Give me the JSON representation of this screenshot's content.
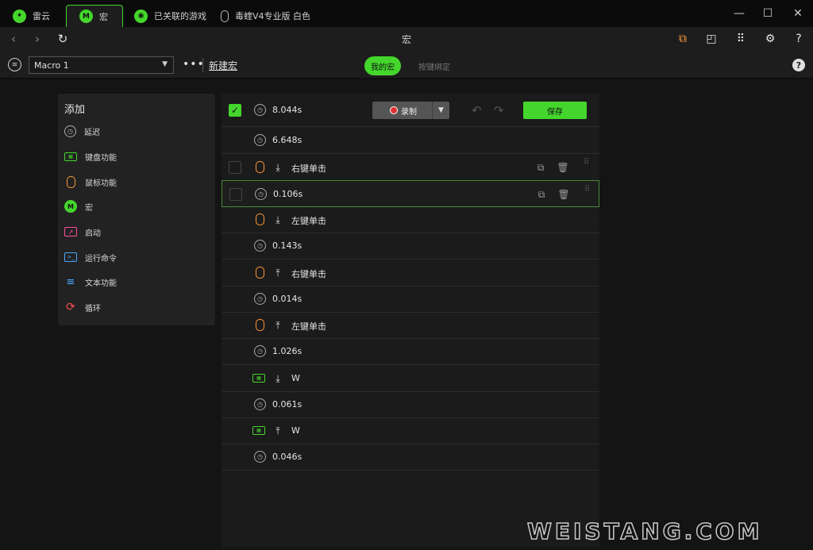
{
  "tabs": [
    {
      "label": "雷云",
      "icon": "razer-logo-icon"
    },
    {
      "label": "宏",
      "icon": "macro-icon",
      "active": true
    },
    {
      "label": "已关联的游戏",
      "icon": "gamepad-icon"
    },
    {
      "label": "毒蝰V4专业版 白色",
      "icon": "mouse-icon"
    }
  ],
  "nav": {
    "title": "宏"
  },
  "toolbar": {
    "macro_select": "Macro 1",
    "more": "•••",
    "new_macro": "新建宏",
    "my_macros": "我的宏",
    "key_binding": "按键绑定"
  },
  "add_panel": {
    "title": "添加",
    "items": [
      {
        "label": "延迟",
        "icon": "clock-icon"
      },
      {
        "label": "键盘功能",
        "icon": "keyboard-icon"
      },
      {
        "label": "鼠标功能",
        "icon": "mouse-icon"
      },
      {
        "label": "宏",
        "icon": "macro-icon"
      },
      {
        "label": "启动",
        "icon": "launch-icon"
      },
      {
        "label": "运行命令",
        "icon": "terminal-icon"
      },
      {
        "label": "文本功能",
        "icon": "text-icon"
      },
      {
        "label": "循环",
        "icon": "loop-icon"
      }
    ]
  },
  "editor": {
    "first_delay": "8.044s",
    "record_label": "录制",
    "save_label": "保存",
    "rows": [
      {
        "type": "delay",
        "text": "6.648s"
      },
      {
        "type": "mouse",
        "dir": "down",
        "text": "右键单击"
      },
      {
        "type": "delay",
        "text": "0.106s",
        "selected": true
      },
      {
        "type": "mouse",
        "dir": "down",
        "text": "左键单击"
      },
      {
        "type": "delay",
        "text": "0.143s"
      },
      {
        "type": "mouse",
        "dir": "up",
        "text": "右键单击"
      },
      {
        "type": "delay",
        "text": "0.014s"
      },
      {
        "type": "mouse",
        "dir": "up",
        "text": "左键单击"
      },
      {
        "type": "delay",
        "text": "1.026s"
      },
      {
        "type": "key",
        "dir": "down",
        "text": "W"
      },
      {
        "type": "delay",
        "text": "0.061s"
      },
      {
        "type": "key",
        "dir": "up",
        "text": "W"
      },
      {
        "type": "delay",
        "text": "0.046s"
      }
    ]
  },
  "watermark": "WEISTANG.COM"
}
